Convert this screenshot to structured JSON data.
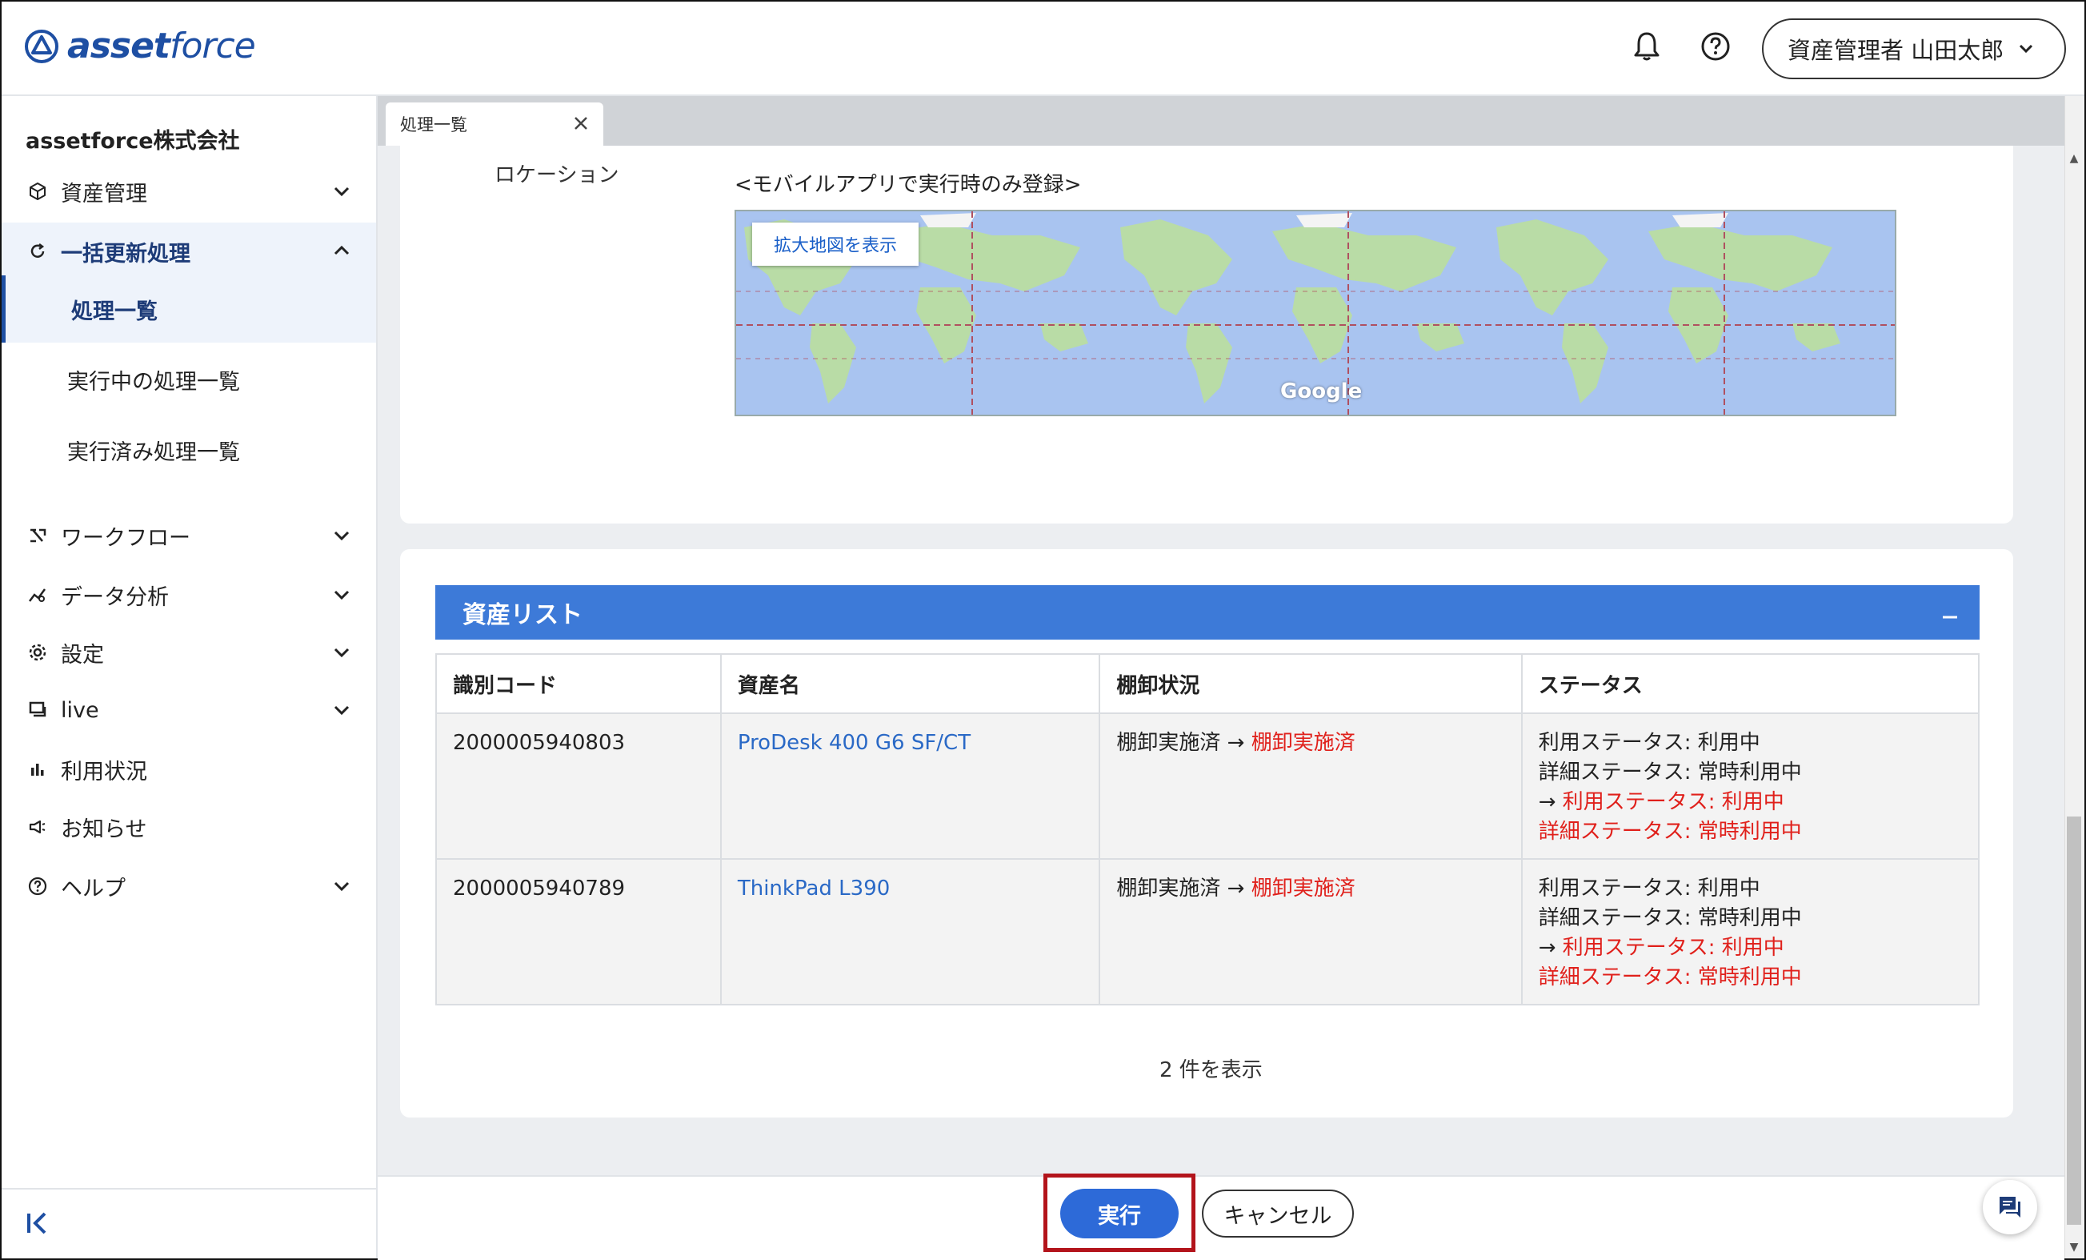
{
  "header": {
    "logo_bold": "asset",
    "logo_light": "force",
    "user_label": "資産管理者 山田太郎"
  },
  "sidebar": {
    "company": "assetforce株式会社",
    "items": [
      {
        "label": "資産管理",
        "icon": "cube-icon"
      },
      {
        "label": "一括更新処理",
        "icon": "refresh-icon"
      },
      {
        "label": "ワークフロー",
        "icon": "workflow-icon"
      },
      {
        "label": "データ分析",
        "icon": "analytics-icon"
      },
      {
        "label": "設定",
        "icon": "gear-icon"
      },
      {
        "label": "live",
        "icon": "live-chat-icon"
      },
      {
        "label": "利用状況",
        "icon": "bar-chart-icon"
      },
      {
        "label": "お知らせ",
        "icon": "megaphone-icon"
      },
      {
        "label": "ヘルプ",
        "icon": "help-icon"
      }
    ],
    "subitems": [
      {
        "label": "処理一覧"
      },
      {
        "label": "実行中の処理一覧"
      },
      {
        "label": "実行済み処理一覧"
      }
    ]
  },
  "tab": {
    "label": "処理一覧"
  },
  "location": {
    "label": "ロケーション",
    "note": "<モバイルアプリで実行時のみ登録>",
    "map_button": "拡大地図を表示",
    "map_brand": "Google"
  },
  "asset_list": {
    "title": "資産リスト",
    "columns": [
      "識別コード",
      "資産名",
      "棚卸状況",
      "ステータス"
    ],
    "rows": [
      {
        "code": "2000005940803",
        "name": "ProDesk 400 G6 SF/CT",
        "inventory_from": "棚卸実施済 → ",
        "inventory_to": "棚卸実施済",
        "status_usage": "利用ステータス: 利用中",
        "status_detail": "詳細ステータス: 常時利用中",
        "new_usage_arrow": "→ ",
        "new_usage": "利用ステータス: 利用中",
        "new_detail": "詳細ステータス: 常時利用中"
      },
      {
        "code": "2000005940789",
        "name": "ThinkPad L390",
        "inventory_from": "棚卸実施済 → ",
        "inventory_to": "棚卸実施済",
        "status_usage": "利用ステータス: 利用中",
        "status_detail": "詳細ステータス: 常時利用中",
        "new_usage_arrow": "→ ",
        "new_usage": "利用ステータス: 利用中",
        "new_detail": "詳細ステータス: 常時利用中"
      }
    ],
    "count_text": "2 件を表示"
  },
  "footer": {
    "execute_label": "実行",
    "cancel_label": "キャンセル"
  },
  "colors": {
    "brand": "#1e4fa3",
    "section_bar": "#3d7ad8",
    "execute_button": "#2d6ad8",
    "highlight": "#b3141b",
    "change_text": "#e0201b",
    "link": "#2a69c6"
  }
}
